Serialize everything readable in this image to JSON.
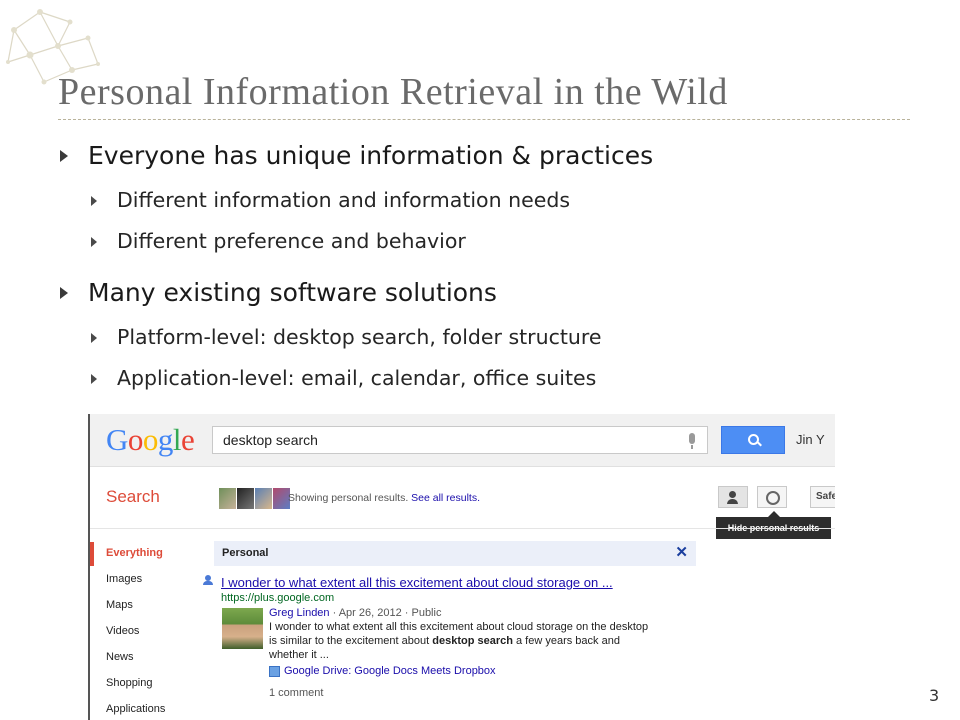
{
  "slide": {
    "title": "Personal Information Retrieval in the Wild",
    "page_number": "3",
    "bullets": [
      {
        "text": "Everyone has unique information & practices",
        "sub": [
          "Different information and information needs",
          "Different preference and behavior"
        ]
      },
      {
        "text": "Many existing software solutions",
        "sub": [
          "Platform-level: desktop search, folder structure",
          "Application-level: email, calendar, office suites"
        ]
      }
    ]
  },
  "screenshot": {
    "logo": "Google",
    "logo_colors": [
      "#4285f4",
      "#ea4335",
      "#fbbc05",
      "#4285f4",
      "#34a853",
      "#ea4335"
    ],
    "query": "desktop search",
    "user": "Jin Y",
    "search_label": "Search",
    "personal_prefix": "Showing personal results.",
    "personal_link": "See all results.",
    "safe_label": "Safe",
    "tooltip": "Hide personal results",
    "nav": [
      "Everything",
      "Images",
      "Maps",
      "Videos",
      "News",
      "Shopping",
      "Applications"
    ],
    "card_title": "Personal",
    "card_close": "✕",
    "result": {
      "title": "I wonder to what extent all this excitement about cloud storage on ...",
      "url": "https://plus.google.com",
      "author": "Greg Linden",
      "meta": " · Apr 26, 2012 · Public",
      "snippet_1": "I wonder to what extent all this excitement about cloud storage on the desktop",
      "snippet_2_pre": "is similar to the excitement about ",
      "snippet_2_bold": "desktop search",
      "snippet_2_post": " a few years back and",
      "snippet_3": "whether it ...",
      "doc_link": "Google Drive: Google Docs Meets Dropbox",
      "comments": "1 comment"
    },
    "accent": "#dd4b39",
    "link_color": "#1a0dab"
  }
}
